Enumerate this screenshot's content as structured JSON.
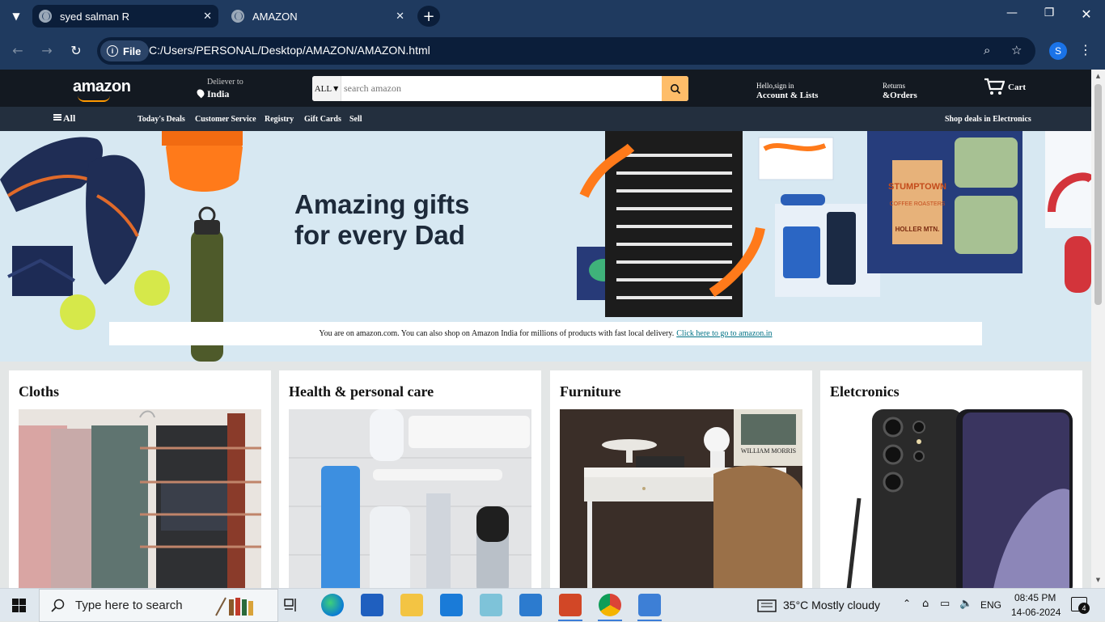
{
  "browser": {
    "tabs": [
      {
        "title": "syed salman R",
        "active": true
      },
      {
        "title": "AMAZON",
        "active": false
      }
    ],
    "file_chip": "File",
    "url": "C:/Users/PERSONAL/Desktop/AMAZON/AMAZON.html",
    "profile_initial": "S"
  },
  "header": {
    "logo": "amazon",
    "deliver_line1": "Deliever to",
    "deliver_line2": "India",
    "search_category": "ALL",
    "search_placeholder": "search amazon",
    "account_line1": "Hello,sign in",
    "account_line2": "Account & Lists",
    "returns_line1": "Returns",
    "returns_line2": "&Orders",
    "cart_label": "Cart"
  },
  "subnav": {
    "all_label": "All",
    "links": [
      "Today's Deals",
      "Customer Service",
      "Registry",
      "Gift Cards",
      "Sell"
    ],
    "right_link": "Shop deals in Electronics"
  },
  "hero": {
    "headline_line1": "Amazing gifts",
    "headline_line2": "for every Dad",
    "notice_text": "You are on amazon.com. You can also shop on Amazon India for millions of products with fast local delivery.",
    "notice_link": "Click here to go to amazon.in",
    "product_labels": {
      "coffee_brand": "STUMPTOWN",
      "coffee_sub": "COFFEE ROASTERS",
      "coffee_variant": "HOLLER MTN."
    }
  },
  "cards": [
    {
      "title": "Cloths"
    },
    {
      "title": "Health & personal care"
    },
    {
      "title": "Furniture",
      "poster_text": "WILLIAM MORRIS"
    },
    {
      "title": "Eletcronics"
    }
  ],
  "taskbar": {
    "search_placeholder": "Type here to search",
    "weather": "35°C  Mostly cloudy",
    "language": "ENG",
    "time": "08:45 PM",
    "date": "14-06-2024",
    "notification_count": "4"
  },
  "colors": {
    "chrome_bg": "#1f3a5f",
    "amazon_header": "#131921",
    "amazon_subnav": "#232f3e",
    "search_button": "#febd69",
    "link": "#007185",
    "hero_bg": "#d7e8f2"
  }
}
